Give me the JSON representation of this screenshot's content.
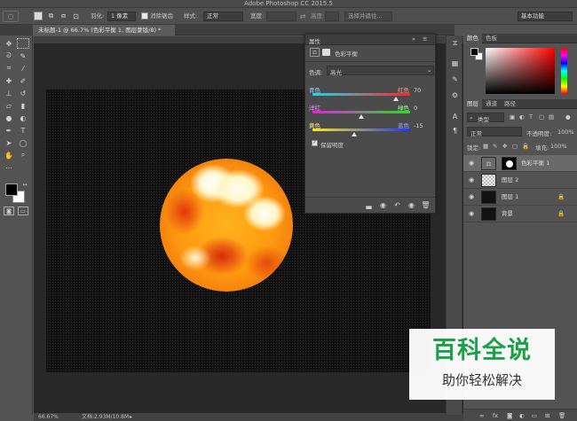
{
  "app": {
    "title": "Adobe Photoshop CC 2015.5"
  },
  "options": {
    "feather_label": "羽化:",
    "feather_value": "1 像素",
    "antialias_label": "消除锯齿",
    "style_label": "样式:",
    "style_value": "正常",
    "width_label": "宽度:",
    "height_label": "高度:",
    "select_mask_label": "选择并遮住...",
    "workspace_value": "基本功能"
  },
  "document": {
    "tab_title": "未标题-1 @ 66.7% (色彩平衡 1, 图层蒙版/8) *",
    "zoom": "66.67%",
    "doc_size": "文档:2.93M/10.8M"
  },
  "properties": {
    "panel_title": "属性",
    "adjustment_name": "色彩平衡",
    "tone_label": "色调:",
    "tone_value": "高光",
    "sliders": [
      {
        "left": "青色",
        "right": "红色",
        "value": 70,
        "value_text": "70"
      },
      {
        "left": "洋红",
        "right": "绿色",
        "value": 0,
        "value_text": "0"
      },
      {
        "left": "黄色",
        "right": "蓝色",
        "value": -15,
        "value_text": "-15"
      }
    ],
    "preserve_luminosity": "保留明度"
  },
  "color_panel": {
    "tabs": [
      "颜色",
      "色板"
    ]
  },
  "layers_panel": {
    "tabs": [
      "图层",
      "通道",
      "路径"
    ],
    "filter_label": "类型",
    "blend_mode": "正常",
    "opacity_label": "不透明度:",
    "opacity_value": "100%",
    "lock_label": "锁定:",
    "fill_label": "填充:",
    "fill_value": "100%",
    "layers": [
      {
        "name": "色彩平衡 1",
        "selected": true
      },
      {
        "name": "图层 2",
        "selected": false
      },
      {
        "name": "图层 1",
        "selected": false
      },
      {
        "name": "背景",
        "selected": false
      }
    ]
  },
  "watermark": {
    "title": "百科全说",
    "subtitle": "助你轻松解决"
  },
  "colors": {
    "accent": "#1aa14a",
    "foreground": "#000000",
    "background": "#ffffff"
  }
}
